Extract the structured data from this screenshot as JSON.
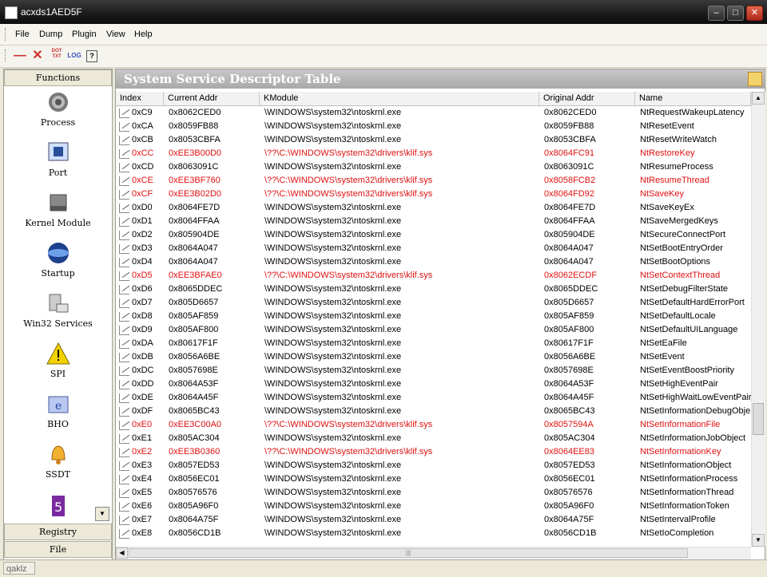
{
  "window": {
    "title": "acxds1AED5F"
  },
  "menu": [
    "File",
    "Dump",
    "Plugin",
    "View",
    "Help"
  ],
  "toolbar": {
    "dot_label": "DOT\nTXT",
    "log_label": "LOG"
  },
  "sidebar": {
    "header": "Functions",
    "items": [
      {
        "label": "Process",
        "icon": "gear-icon"
      },
      {
        "label": "Port",
        "icon": "network-icon"
      },
      {
        "label": "Kernel Module",
        "icon": "hard-drive-icon"
      },
      {
        "label": "Startup",
        "icon": "startup-globe-icon"
      },
      {
        "label": "Win32 Services",
        "icon": "computer-icon"
      },
      {
        "label": "SPI",
        "icon": "warning-icon"
      },
      {
        "label": "BHO",
        "icon": "ie-folder-icon"
      },
      {
        "label": "SSDT",
        "icon": "bell-icon"
      }
    ],
    "bottom_tabs": [
      "Registry",
      "File"
    ]
  },
  "panel": {
    "title": "System Service Descriptor Table",
    "columns": [
      "Index",
      "Current Addr",
      "KModule",
      "Original Addr",
      "Name"
    ],
    "rows": [
      {
        "index": "0xC9",
        "current": "0x8062CED0",
        "module": "\\WINDOWS\\system32\\ntoskrnl.exe",
        "original": "0x8062CED0",
        "name": "NtRequestWakeupLatency",
        "hooked": false
      },
      {
        "index": "0xCA",
        "current": "0x8059FB88",
        "module": "\\WINDOWS\\system32\\ntoskrnl.exe",
        "original": "0x8059FB88",
        "name": "NtResetEvent",
        "hooked": false
      },
      {
        "index": "0xCB",
        "current": "0x8053CBFA",
        "module": "\\WINDOWS\\system32\\ntoskrnl.exe",
        "original": "0x8053CBFA",
        "name": "NtResetWriteWatch",
        "hooked": false
      },
      {
        "index": "0xCC",
        "current": "0xEE3B00D0",
        "module": "\\??\\C:\\WINDOWS\\system32\\drivers\\klif.sys",
        "original": "0x8064FC91",
        "name": "NtRestoreKey",
        "hooked": true
      },
      {
        "index": "0xCD",
        "current": "0x8063091C",
        "module": "\\WINDOWS\\system32\\ntoskrnl.exe",
        "original": "0x8063091C",
        "name": "NtResumeProcess",
        "hooked": false
      },
      {
        "index": "0xCE",
        "current": "0xEE3BF760",
        "module": "\\??\\C:\\WINDOWS\\system32\\drivers\\klif.sys",
        "original": "0x8058FCB2",
        "name": "NtResumeThread",
        "hooked": true
      },
      {
        "index": "0xCF",
        "current": "0xEE3B02D0",
        "module": "\\??\\C:\\WINDOWS\\system32\\drivers\\klif.sys",
        "original": "0x8064FD92",
        "name": "NtSaveKey",
        "hooked": true
      },
      {
        "index": "0xD0",
        "current": "0x8064FE7D",
        "module": "\\WINDOWS\\system32\\ntoskrnl.exe",
        "original": "0x8064FE7D",
        "name": "NtSaveKeyEx",
        "hooked": false
      },
      {
        "index": "0xD1",
        "current": "0x8064FFAA",
        "module": "\\WINDOWS\\system32\\ntoskrnl.exe",
        "original": "0x8064FFAA",
        "name": "NtSaveMergedKeys",
        "hooked": false
      },
      {
        "index": "0xD2",
        "current": "0x805904DE",
        "module": "\\WINDOWS\\system32\\ntoskrnl.exe",
        "original": "0x805904DE",
        "name": "NtSecureConnectPort",
        "hooked": false
      },
      {
        "index": "0xD3",
        "current": "0x8064A047",
        "module": "\\WINDOWS\\system32\\ntoskrnl.exe",
        "original": "0x8064A047",
        "name": "NtSetBootEntryOrder",
        "hooked": false
      },
      {
        "index": "0xD4",
        "current": "0x8064A047",
        "module": "\\WINDOWS\\system32\\ntoskrnl.exe",
        "original": "0x8064A047",
        "name": "NtSetBootOptions",
        "hooked": false
      },
      {
        "index": "0xD5",
        "current": "0xEE3BFAE0",
        "module": "\\??\\C:\\WINDOWS\\system32\\drivers\\klif.sys",
        "original": "0x8062ECDF",
        "name": "NtSetContextThread",
        "hooked": true
      },
      {
        "index": "0xD6",
        "current": "0x8065DDEC",
        "module": "\\WINDOWS\\system32\\ntoskrnl.exe",
        "original": "0x8065DDEC",
        "name": "NtSetDebugFilterState",
        "hooked": false
      },
      {
        "index": "0xD7",
        "current": "0x805D6657",
        "module": "\\WINDOWS\\system32\\ntoskrnl.exe",
        "original": "0x805D6657",
        "name": "NtSetDefaultHardErrorPort",
        "hooked": false
      },
      {
        "index": "0xD8",
        "current": "0x805AF859",
        "module": "\\WINDOWS\\system32\\ntoskrnl.exe",
        "original": "0x805AF859",
        "name": "NtSetDefaultLocale",
        "hooked": false
      },
      {
        "index": "0xD9",
        "current": "0x805AF800",
        "module": "\\WINDOWS\\system32\\ntoskrnl.exe",
        "original": "0x805AF800",
        "name": "NtSetDefaultUILanguage",
        "hooked": false
      },
      {
        "index": "0xDA",
        "current": "0x80617F1F",
        "module": "\\WINDOWS\\system32\\ntoskrnl.exe",
        "original": "0x80617F1F",
        "name": "NtSetEaFile",
        "hooked": false
      },
      {
        "index": "0xDB",
        "current": "0x8056A6BE",
        "module": "\\WINDOWS\\system32\\ntoskrnl.exe",
        "original": "0x8056A6BE",
        "name": "NtSetEvent",
        "hooked": false
      },
      {
        "index": "0xDC",
        "current": "0x8057698E",
        "module": "\\WINDOWS\\system32\\ntoskrnl.exe",
        "original": "0x8057698E",
        "name": "NtSetEventBoostPriority",
        "hooked": false
      },
      {
        "index": "0xDD",
        "current": "0x8064A53F",
        "module": "\\WINDOWS\\system32\\ntoskrnl.exe",
        "original": "0x8064A53F",
        "name": "NtSetHighEventPair",
        "hooked": false
      },
      {
        "index": "0xDE",
        "current": "0x8064A45F",
        "module": "\\WINDOWS\\system32\\ntoskrnl.exe",
        "original": "0x8064A45F",
        "name": "NtSetHighWaitLowEventPair",
        "hooked": false
      },
      {
        "index": "0xDF",
        "current": "0x8065BC43",
        "module": "\\WINDOWS\\system32\\ntoskrnl.exe",
        "original": "0x8065BC43",
        "name": "NtSetInformationDebugObje",
        "hooked": false
      },
      {
        "index": "0xE0",
        "current": "0xEE3C00A0",
        "module": "\\??\\C:\\WINDOWS\\system32\\drivers\\klif.sys",
        "original": "0x8057594A",
        "name": "NtSetInformationFile",
        "hooked": true
      },
      {
        "index": "0xE1",
        "current": "0x805AC304",
        "module": "\\WINDOWS\\system32\\ntoskrnl.exe",
        "original": "0x805AC304",
        "name": "NtSetInformationJobObject",
        "hooked": false
      },
      {
        "index": "0xE2",
        "current": "0xEE3B0360",
        "module": "\\??\\C:\\WINDOWS\\system32\\drivers\\klif.sys",
        "original": "0x8064EE83",
        "name": "NtSetInformationKey",
        "hooked": true
      },
      {
        "index": "0xE3",
        "current": "0x8057ED53",
        "module": "\\WINDOWS\\system32\\ntoskrnl.exe",
        "original": "0x8057ED53",
        "name": "NtSetInformationObject",
        "hooked": false
      },
      {
        "index": "0xE4",
        "current": "0x8056EC01",
        "module": "\\WINDOWS\\system32\\ntoskrnl.exe",
        "original": "0x8056EC01",
        "name": "NtSetInformationProcess",
        "hooked": false
      },
      {
        "index": "0xE5",
        "current": "0x80576576",
        "module": "\\WINDOWS\\system32\\ntoskrnl.exe",
        "original": "0x80576576",
        "name": "NtSetInformationThread",
        "hooked": false
      },
      {
        "index": "0xE6",
        "current": "0x805A96F0",
        "module": "\\WINDOWS\\system32\\ntoskrnl.exe",
        "original": "0x805A96F0",
        "name": "NtSetInformationToken",
        "hooked": false
      },
      {
        "index": "0xE7",
        "current": "0x8064A75F",
        "module": "\\WINDOWS\\system32\\ntoskrnl.exe",
        "original": "0x8064A75F",
        "name": "NtSetIntervalProfile",
        "hooked": false
      },
      {
        "index": "0xE8",
        "current": "0x8056CD1B",
        "module": "\\WINDOWS\\system32\\ntoskrnl.exe",
        "original": "0x8056CD1B",
        "name": "NtSetIoCompletion",
        "hooked": false
      }
    ]
  },
  "status": {
    "text": "qaklz"
  },
  "colors": {
    "hooked": "#e01010",
    "normal": "#000000",
    "header": "#b0b0b0"
  }
}
